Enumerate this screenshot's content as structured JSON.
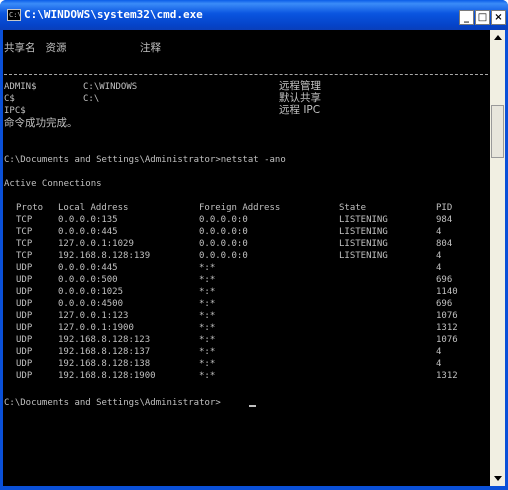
{
  "window": {
    "title": "C:\\WINDOWS\\system32\\cmd.exe",
    "icon": "cmd-app-icon",
    "icon_glyph": "C:\\"
  },
  "controls": {
    "minimize": "_",
    "maximize": "□",
    "close": "×"
  },
  "share": {
    "header": "共享名   资源                      注释",
    "rows": [
      {
        "name": "ADMIN$",
        "resource": "C:\\WINDOWS",
        "remark": "远程管理"
      },
      {
        "name": "C$",
        "resource": "C:\\",
        "remark": "默认共享"
      },
      {
        "name": "IPC$",
        "resource": "",
        "remark": "远程 IPC"
      }
    ],
    "success": "命令成功完成。"
  },
  "terminal": {
    "command1": "C:\\Documents and Settings\\Administrator>netstat -ano",
    "heading": "Active Connections",
    "columns": [
      "Proto",
      "Local Address",
      "Foreign Address",
      "State",
      "PID"
    ],
    "connections": [
      {
        "proto": "TCP",
        "local": "0.0.0.0:135",
        "foreign": "0.0.0.0:0",
        "state": "LISTENING",
        "pid": "984"
      },
      {
        "proto": "TCP",
        "local": "0.0.0.0:445",
        "foreign": "0.0.0.0:0",
        "state": "LISTENING",
        "pid": "4"
      },
      {
        "proto": "TCP",
        "local": "127.0.0.1:1029",
        "foreign": "0.0.0.0:0",
        "state": "LISTENING",
        "pid": "804"
      },
      {
        "proto": "TCP",
        "local": "192.168.8.128:139",
        "foreign": "0.0.0.0:0",
        "state": "LISTENING",
        "pid": "4"
      },
      {
        "proto": "UDP",
        "local": "0.0.0.0:445",
        "foreign": "*:*",
        "state": "",
        "pid": "4"
      },
      {
        "proto": "UDP",
        "local": "0.0.0.0:500",
        "foreign": "*:*",
        "state": "",
        "pid": "696"
      },
      {
        "proto": "UDP",
        "local": "0.0.0.0:1025",
        "foreign": "*:*",
        "state": "",
        "pid": "1140"
      },
      {
        "proto": "UDP",
        "local": "0.0.0.0:4500",
        "foreign": "*:*",
        "state": "",
        "pid": "696"
      },
      {
        "proto": "UDP",
        "local": "127.0.0.1:123",
        "foreign": "*:*",
        "state": "",
        "pid": "1076"
      },
      {
        "proto": "UDP",
        "local": "127.0.0.1:1900",
        "foreign": "*:*",
        "state": "",
        "pid": "1312"
      },
      {
        "proto": "UDP",
        "local": "192.168.8.128:123",
        "foreign": "*:*",
        "state": "",
        "pid": "1076"
      },
      {
        "proto": "UDP",
        "local": "192.168.8.128:137",
        "foreign": "*:*",
        "state": "",
        "pid": "4"
      },
      {
        "proto": "UDP",
        "local": "192.168.8.128:138",
        "foreign": "*:*",
        "state": "",
        "pid": "4"
      },
      {
        "proto": "UDP",
        "local": "192.168.8.128:1900",
        "foreign": "*:*",
        "state": "",
        "pid": "1312"
      }
    ],
    "prompt": "C:\\Documents and Settings\\Administrator>"
  },
  "colors": {
    "console_bg": "#000000",
    "console_text": "#c0c0c0",
    "titlebar": "#0a55e0",
    "close_button": "#ffffff"
  }
}
